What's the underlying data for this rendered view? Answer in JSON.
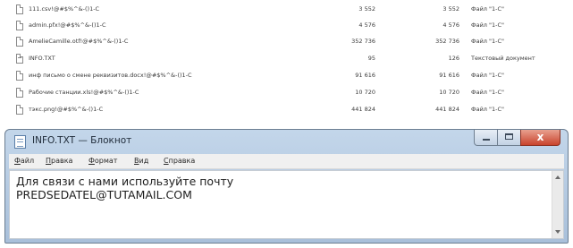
{
  "files": [
    {
      "name": "111.csv!@#$%^&-()1-C",
      "size1": "3 552",
      "size2": "3 552",
      "type": "Файл \"1-C\"",
      "icon": "file-icon"
    },
    {
      "name": "admin.pfx!@#$%^&-()1-C",
      "size1": "4 576",
      "size2": "4 576",
      "type": "Файл \"1-C\"",
      "icon": "file-icon"
    },
    {
      "name": "AmelieCamille.otf!@#$%^&-()1-C",
      "size1": "352 736",
      "size2": "352 736",
      "type": "Файл \"1-C\"",
      "icon": "file-icon"
    },
    {
      "name": "INFO.TXT",
      "size1": "95",
      "size2": "126",
      "type": "Текстовый документ",
      "icon": "text-file-icon"
    },
    {
      "name": "инф письмо о смене реквизитов.docx!@#$%^&-()1-C",
      "size1": "91 616",
      "size2": "91 616",
      "type": "Файл \"1-C\"",
      "icon": "file-icon"
    },
    {
      "name": "Рабочие станции.xls!@#$%^&-()1-C",
      "size1": "10 720",
      "size2": "10 720",
      "type": "Файл \"1-C\"",
      "icon": "file-icon"
    },
    {
      "name": "тэкс.png!@#$%^&-()1-C",
      "size1": "441 824",
      "size2": "441 824",
      "type": "Файл \"1-C\"",
      "icon": "file-icon"
    }
  ],
  "notepad": {
    "title": "INFO.TXT — Блокнот",
    "close_glyph": "x",
    "menu": [
      "Файл",
      "Правка",
      "Формат",
      "Вид",
      "Справка"
    ],
    "text_line1": "Для связи с нами используйте почту",
    "text_line2": "PREDSEDATEL@TUTAMAIL.COM"
  },
  "colors": {
    "titlebar": "#b8cde4",
    "close_button": "#c9442d",
    "text": "#1e1e1e"
  }
}
